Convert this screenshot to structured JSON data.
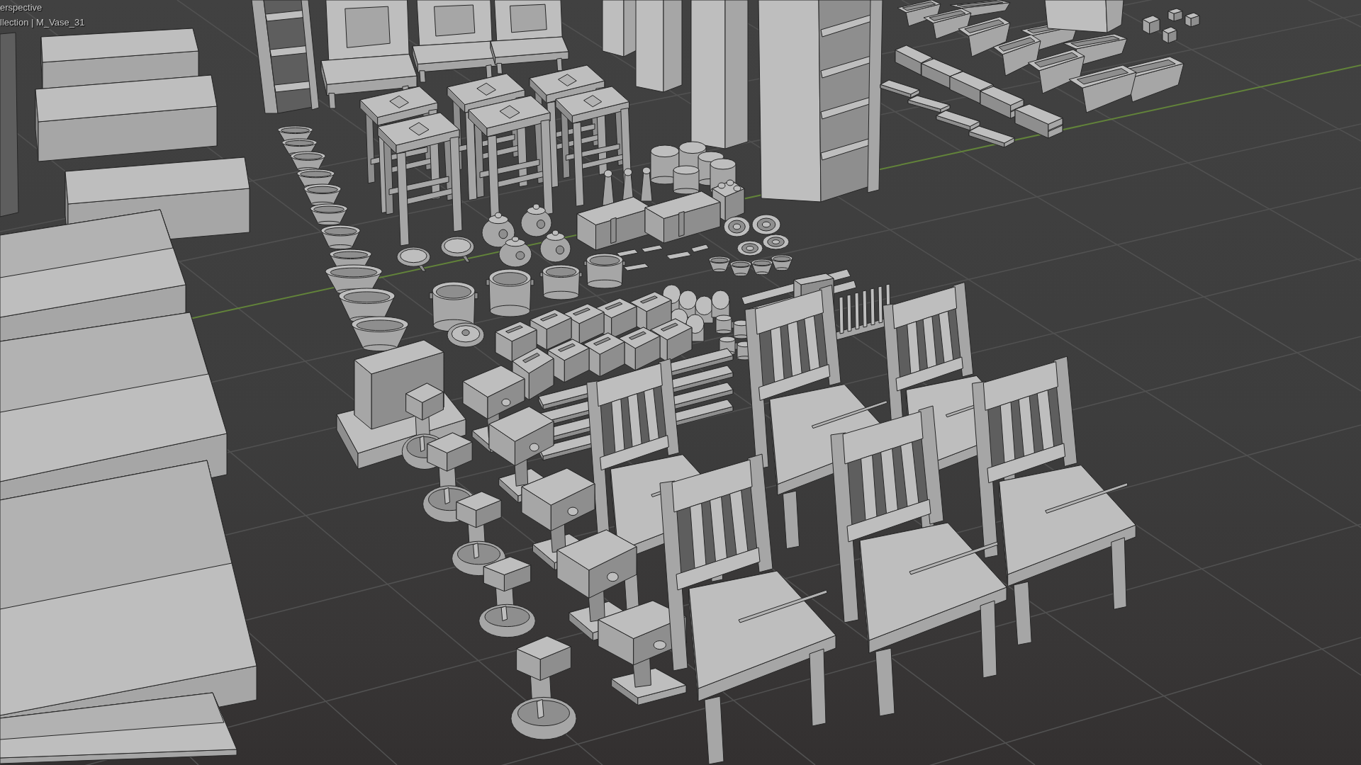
{
  "viewport": {
    "view_label": "erspective",
    "collection_label": "llection | M_Vase_31"
  }
}
